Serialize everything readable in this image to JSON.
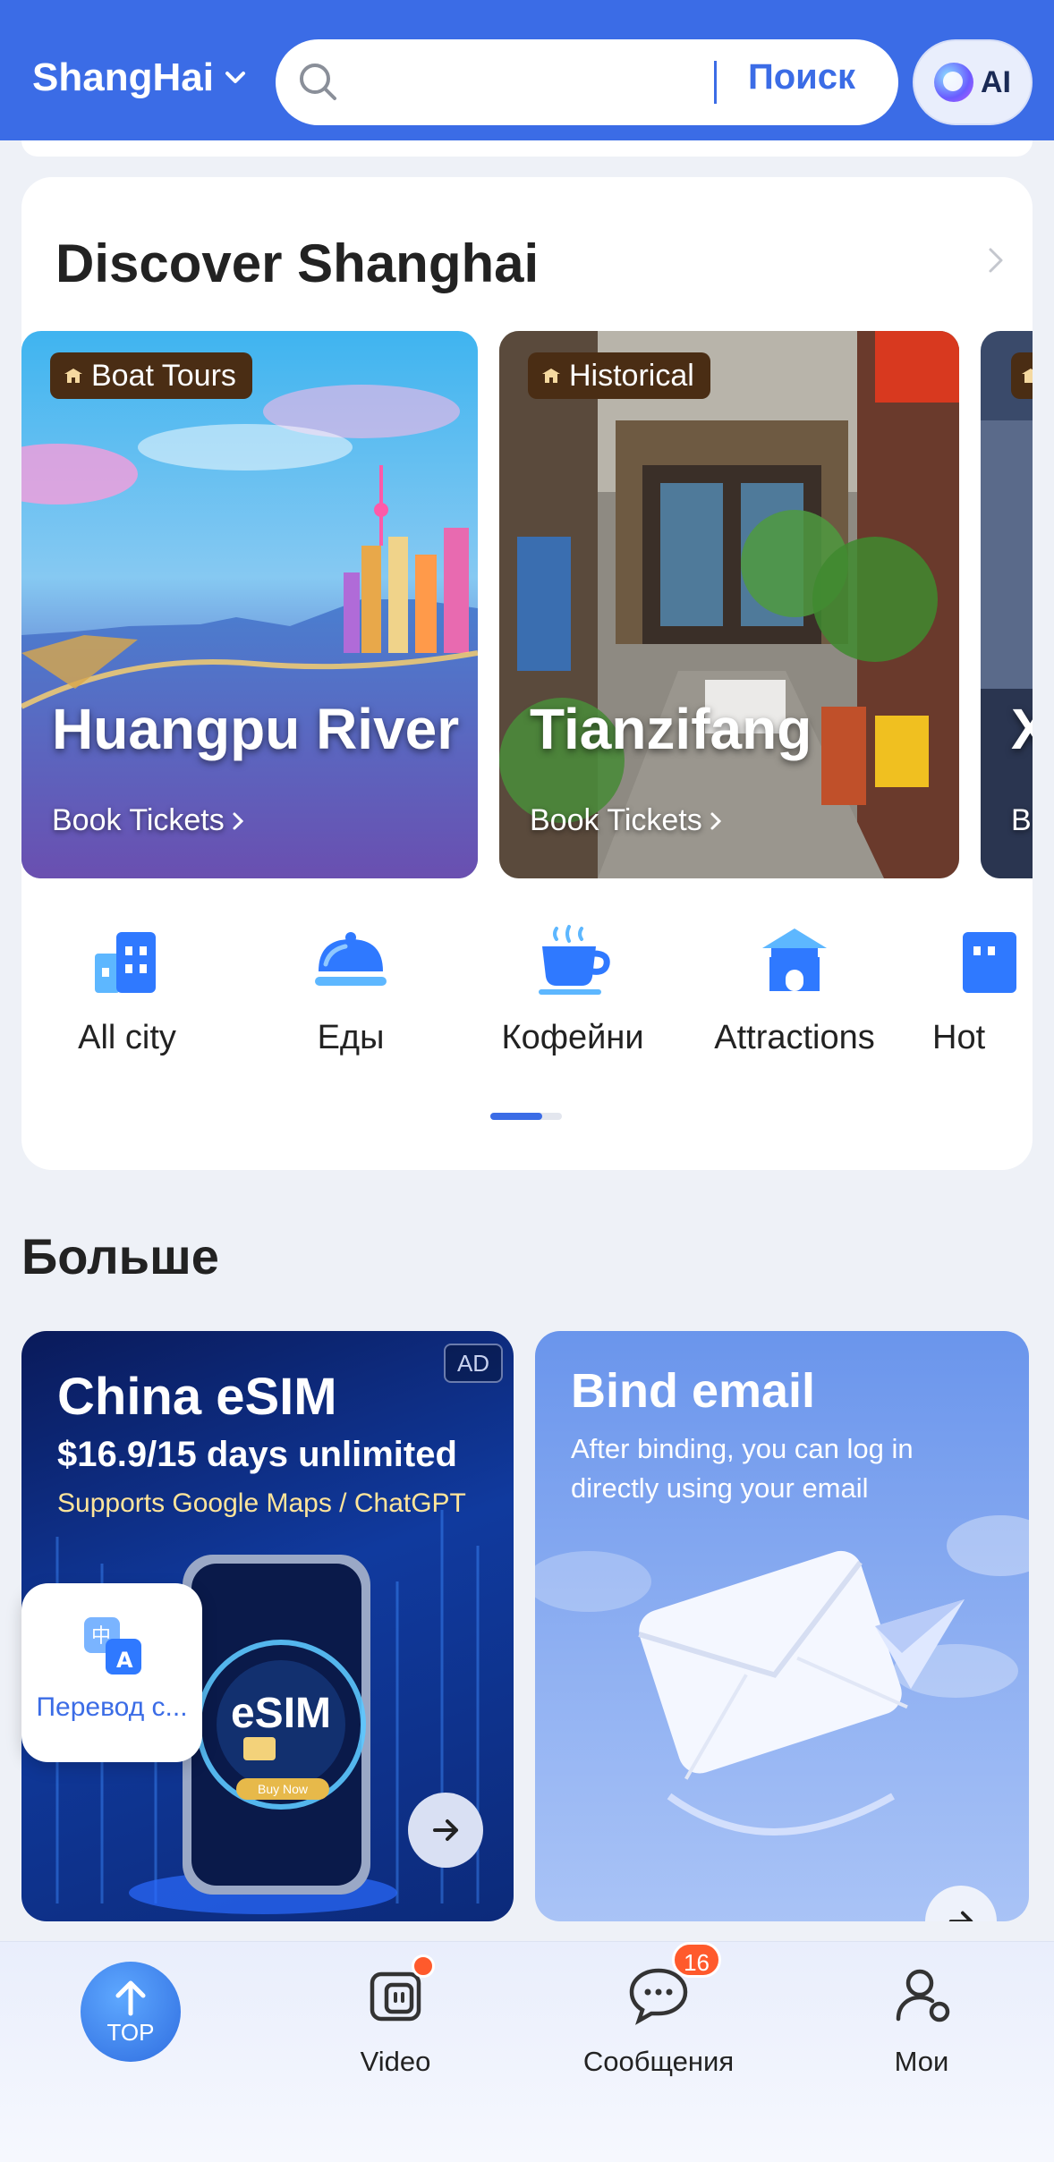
{
  "header": {
    "city": "ShangHai",
    "search_placeholder": "",
    "search_button": "Поиск",
    "ai_label": "AI",
    "background_color": "#3b6ce6"
  },
  "discover": {
    "title": "Discover Shanghai",
    "tiles": [
      {
        "badge": "Boat Tours",
        "title": "Huangpu River",
        "action": "Book Tickets"
      },
      {
        "badge": "Historical",
        "title": "Tianzifang",
        "action": "Book Tickets"
      },
      {
        "badge": "",
        "title": "X",
        "action": "B"
      }
    ],
    "categories": [
      {
        "label": "All city",
        "icon": "city-buildings-icon"
      },
      {
        "label": "Еды",
        "icon": "food-cloche-icon"
      },
      {
        "label": "Кофейни",
        "icon": "coffee-cup-icon"
      },
      {
        "label": "Attractions",
        "icon": "pagoda-icon"
      },
      {
        "label": "Hot",
        "icon": "hotel-building-icon"
      }
    ]
  },
  "more": {
    "title": "Больше",
    "esim": {
      "ad": "AD",
      "title": "China eSIM",
      "price": "$16.9/15 days unlimited",
      "supports": "Supports Google Maps / ChatGPT",
      "chip_text": "eSIM",
      "buy_text": "Buy Now"
    },
    "bind": {
      "title": "Bind email",
      "subtitle": "After binding, you can log in directly using your email"
    },
    "translate": {
      "label": "Перевод с..."
    }
  },
  "bottom_nav": {
    "top": "TOP",
    "video": "Video",
    "messages": "Сообщения",
    "messages_badge": "16",
    "mine": "Мои"
  },
  "colors": {
    "accent": "#3b6ce6",
    "badge_bg": "#4a2d14",
    "notification": "#ff5a2c"
  }
}
